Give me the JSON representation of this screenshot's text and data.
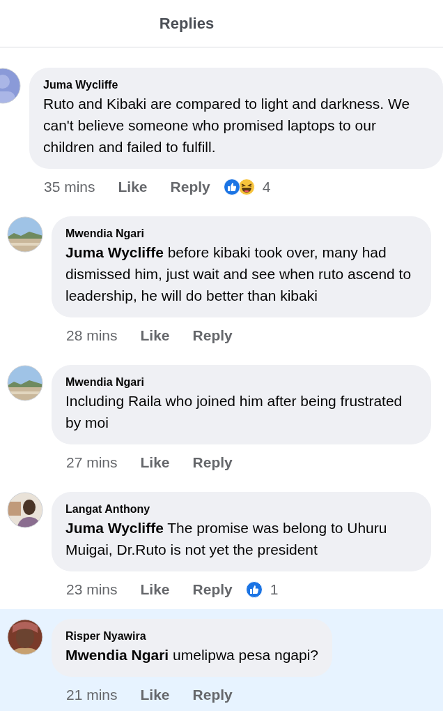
{
  "header": {
    "title": "Replies"
  },
  "comments": [
    {
      "kind": "parent",
      "highlighted": false,
      "author": "Juma Wycliffe",
      "text": "Ruto and Kibaki are compared to light and darkness. We can't believe someone who promised laptops to our children and failed to fulfill.",
      "time": "35 mins",
      "like": "Like",
      "reply": "Reply",
      "reactions": [
        {
          "kind": "like"
        },
        {
          "kind": "haha"
        }
      ],
      "reaction_count": "4"
    },
    {
      "kind": "reply",
      "highlighted": false,
      "author": "Mwendia Ngari",
      "text": "**Juma Wycliffe** before kibaki took over, many had dismissed him, just wait and see when ruto ascend to leadership, he will do better than kibaki",
      "time": "28 mins",
      "like": "Like",
      "reply": "Reply"
    },
    {
      "kind": "reply",
      "highlighted": false,
      "author": "Mwendia Ngari",
      "text": "Including Raila who joined him after being frustrated by moi",
      "time": "27 mins",
      "like": "Like",
      "reply": "Reply"
    },
    {
      "kind": "reply",
      "highlighted": false,
      "author": "Langat Anthony",
      "text": "**Juma Wycliffe** The promise was belong to Uhuru Muigai, Dr.Ruto is not yet the president",
      "time": "23 mins",
      "like": "Like",
      "reply": "Reply",
      "reactions": [
        {
          "kind": "like"
        }
      ],
      "reaction_count": "1"
    },
    {
      "kind": "reply",
      "highlighted": true,
      "author": "Risper Nyawira",
      "text": "**Mwendia Ngari** umelipwa pesa ngapi?",
      "time": "21 mins",
      "like": "Like",
      "reply": "Reply"
    }
  ]
}
